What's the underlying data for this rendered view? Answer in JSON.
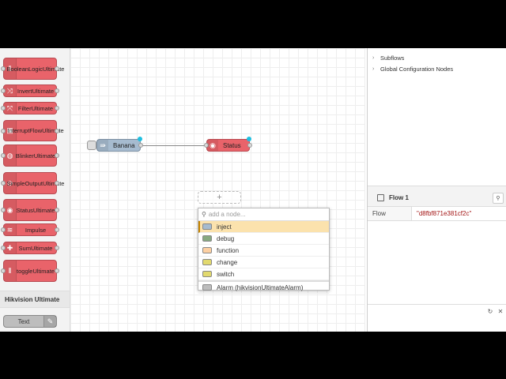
{
  "palette": {
    "nodes": [
      {
        "label": "BooleanLogicUltimate",
        "icon": "sliders-icon",
        "glyph": "⫴"
      },
      {
        "label": "InvertUltimate",
        "icon": "shuffle-icon",
        "glyph": "⤨"
      },
      {
        "label": "FilterUltimate",
        "icon": "split-icon",
        "glyph": "⤧"
      },
      {
        "label": "InterruptFlowUltimate",
        "icon": "door-icon",
        "glyph": "▣"
      },
      {
        "label": "BlinkerUltimate",
        "icon": "lamp-icon",
        "glyph": "◍"
      },
      {
        "label": "SimpleOutputUltimate",
        "icon": "circle-minus-icon",
        "glyph": "⊖"
      },
      {
        "label": "StatusUltimate",
        "icon": "eye-icon",
        "glyph": "◉"
      },
      {
        "label": "Impulse",
        "icon": "wifi-icon",
        "glyph": "≋"
      },
      {
        "label": "SumUltimate",
        "icon": "plus-icon",
        "glyph": "✚"
      },
      {
        "label": "toggleUltimate",
        "icon": "sliders-icon",
        "glyph": "⫴"
      }
    ],
    "category": "Hikvision Ultimate",
    "text_node": {
      "label": "Text",
      "icon": "edit-icon",
      "glyph": "✎"
    }
  },
  "flow": {
    "nodes": [
      {
        "label": "Banana",
        "icon": "arrow-right-icon",
        "glyph": "⇛",
        "color": "#a6bbcf"
      },
      {
        "label": "Status",
        "icon": "eye-icon",
        "glyph": "◉",
        "color": "#e9636a"
      }
    ],
    "dropzone_glyph": "+"
  },
  "quick_add": {
    "search_placeholder": "add a node...",
    "items": [
      {
        "label": "inject",
        "color": "#a6bbcf",
        "selected": true
      },
      {
        "label": "debug",
        "color": "#87a980",
        "selected": false
      },
      {
        "label": "function",
        "color": "#fdd0a2",
        "selected": false
      },
      {
        "label": "change",
        "color": "#e2d96e",
        "selected": false
      },
      {
        "label": "switch",
        "color": "#e2d96e",
        "selected": false
      }
    ],
    "extra_item": {
      "label": "Alarm (hikvisionUltimateAlarm)",
      "color": "#bdbdbd"
    }
  },
  "sidebar": {
    "tree": [
      {
        "label": "Subflows"
      },
      {
        "label": "Global Configuration Nodes"
      }
    ],
    "info_title": "Flow 1",
    "properties": [
      {
        "key": "Flow",
        "value": "\"d8fbf871e381cf2c\""
      }
    ]
  }
}
